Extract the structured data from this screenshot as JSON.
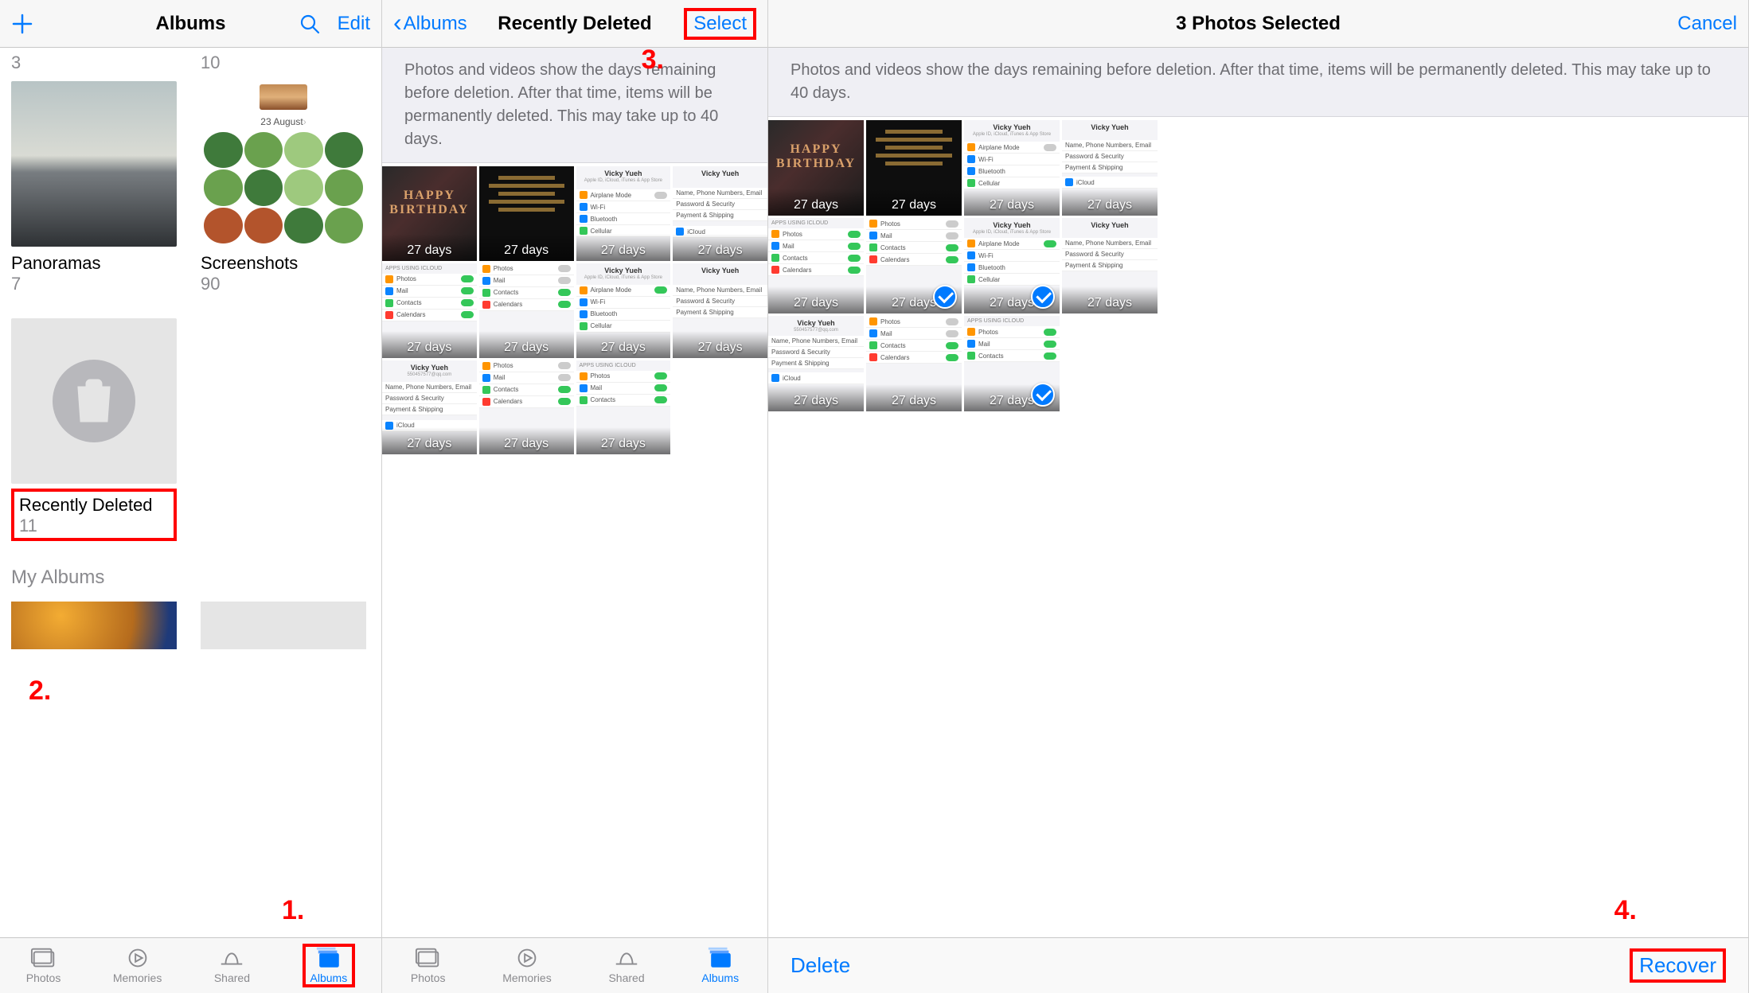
{
  "pane1": {
    "nav": {
      "title": "Albums",
      "edit": "Edit"
    },
    "top_counts": {
      "left": "3",
      "right": "10"
    },
    "albums": {
      "panoramas": {
        "title": "Panoramas",
        "count": "7"
      },
      "screenshots": {
        "title": "Screenshots",
        "count": "90",
        "date_label": "23 August"
      },
      "recently_deleted": {
        "title": "Recently Deleted",
        "count": "11"
      }
    },
    "section_header": "My Albums",
    "tabs": {
      "photos": "Photos",
      "memories": "Memories",
      "shared": "Shared",
      "albums": "Albums"
    }
  },
  "pane2": {
    "nav": {
      "back": "Albums",
      "title": "Recently Deleted",
      "select": "Select"
    },
    "info": "Photos and videos show the days remaining before deletion. After that time, items will be permanently deleted. This may take up to 40 days.",
    "days_label": "27 days",
    "tabs": {
      "photos": "Photos",
      "memories": "Memories",
      "shared": "Shared",
      "albums": "Albums"
    }
  },
  "pane3": {
    "nav": {
      "title": "3 Photos Selected",
      "cancel": "Cancel"
    },
    "info": "Photos and videos show the days remaining before deletion. After that time, items will be permanently deleted. This may take up to 40 days.",
    "days_label": "27 days",
    "actions": {
      "delete": "Delete",
      "recover": "Recover"
    }
  },
  "fake_screenshot": {
    "name": "Vicky Yueh",
    "rows": {
      "airplane": "Airplane Mode",
      "wifi": "Wi-Fi",
      "bluetooth": "Bluetooth",
      "cellular": "Cellular",
      "photos": "Photos",
      "mail": "Mail",
      "contacts": "Contacts",
      "calendars": "Calendars",
      "icloud": "iCloud",
      "header1": "APPS USING ICLOUD",
      "nfo": "Name, Phone Numbers, Email",
      "pwd": "Password & Security",
      "pay": "Payment & Shipping"
    }
  },
  "bday": {
    "l1": "HAPPY",
    "l2": "BIRTHDAY"
  },
  "steps": {
    "s1": "1.",
    "s2": "2.",
    "s3": "3.",
    "s4": "4."
  }
}
